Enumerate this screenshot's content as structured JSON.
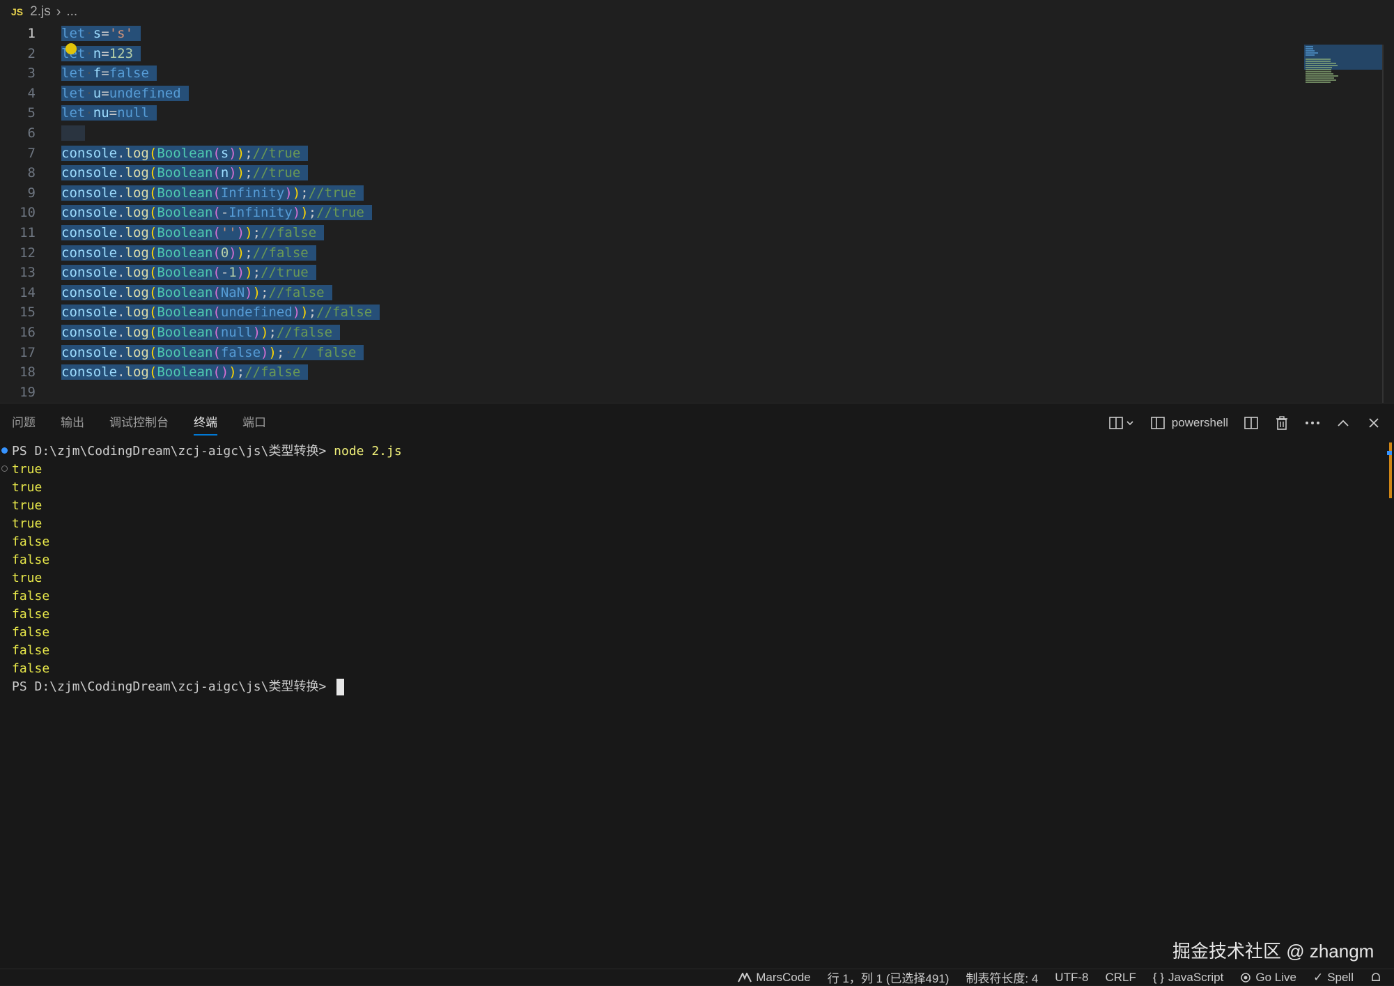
{
  "breadcrumb": {
    "file_badge": "JS",
    "file": "2.js",
    "rest": "..."
  },
  "editor": {
    "line_numbers": [
      "1",
      "2",
      "3",
      "4",
      "5",
      "6",
      "7",
      "8",
      "9",
      "10",
      "11",
      "12",
      "13",
      "14",
      "15",
      "16",
      "17",
      "18",
      "19"
    ],
    "lines": [
      "let s='s'",
      "let n=123",
      "let f=false",
      "let u=undefined",
      "let nu=null",
      "",
      "console.log(Boolean(s));//true",
      "console.log(Boolean(n));//true",
      "console.log(Boolean(Infinity));//true",
      "console.log(Boolean(-Infinity));//true",
      "console.log(Boolean(''));//false",
      "console.log(Boolean(0));//false",
      "console.log(Boolean(-1));//true",
      "console.log(Boolean(NaN));//false",
      "console.log(Boolean(undefined));//false",
      "console.log(Boolean(null));//false",
      "console.log(Boolean(false)); // false",
      "console.log(Boolean());//false",
      ""
    ]
  },
  "panel": {
    "tabs": [
      "问题",
      "输出",
      "调试控制台",
      "终端",
      "端口"
    ],
    "active_tab": "终端",
    "terminal_name": "powershell"
  },
  "terminal": {
    "prompt": "PS D:\\zjm\\CodingDream\\zcj-aigc\\js\\类型转换> ",
    "command": "node 2.js",
    "output": [
      "true",
      "true",
      "true",
      "true",
      "false",
      "false",
      "true",
      "false",
      "false",
      "false",
      "false",
      "false"
    ]
  },
  "watermark": "掘金技术社区 @ zhangm",
  "statusbar": {
    "marscode": "MarsCode",
    "position": "行 1，列 1 (已选择491)",
    "tab_size": "制表符长度: 4",
    "encoding": "UTF-8",
    "eol": "CRLF",
    "language": "JavaScript",
    "golive": "Go Live",
    "spell": "Spell"
  },
  "colors": {
    "accent": "#0078d4",
    "terminal_output": "#e8e84a",
    "selection": "#264f78"
  }
}
